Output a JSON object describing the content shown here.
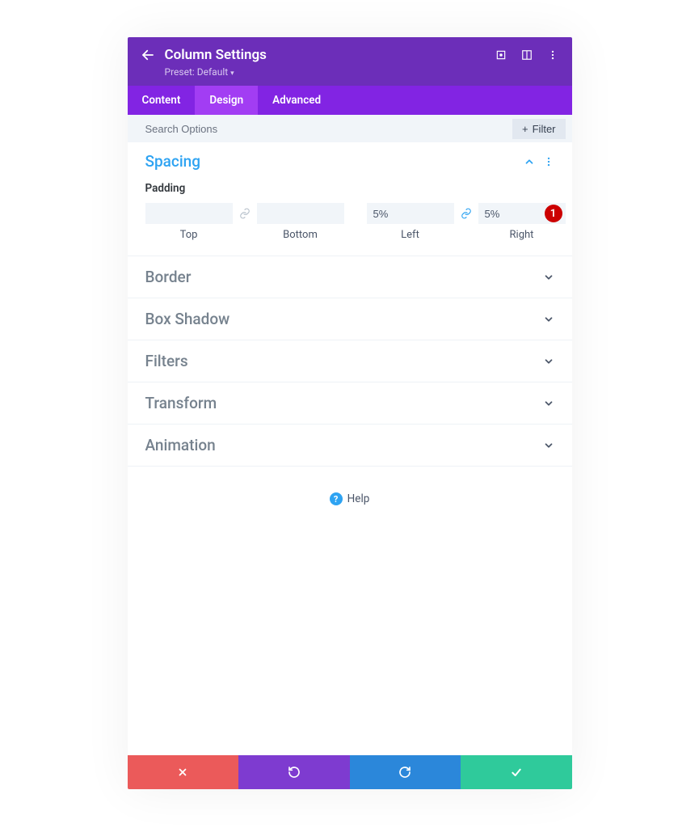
{
  "header": {
    "title": "Column Settings",
    "preset_label": "Preset:",
    "preset_value": "Default"
  },
  "tabs": [
    {
      "id": "content",
      "label": "Content",
      "active": false
    },
    {
      "id": "design",
      "label": "Design",
      "active": true
    },
    {
      "id": "advanced",
      "label": "Advanced",
      "active": false
    }
  ],
  "search": {
    "placeholder": "Search Options",
    "filter_label": "Filter"
  },
  "spacing": {
    "title": "Spacing",
    "subtitle": "Padding",
    "top": {
      "value": "",
      "label": "Top"
    },
    "bottom": {
      "value": "",
      "label": "Bottom"
    },
    "left": {
      "value": "5%",
      "label": "Left"
    },
    "right": {
      "value": "5%",
      "label": "Right"
    },
    "badge": "1"
  },
  "sections": [
    {
      "id": "border",
      "title": "Border"
    },
    {
      "id": "boxshadow",
      "title": "Box Shadow"
    },
    {
      "id": "filters",
      "title": "Filters"
    },
    {
      "id": "transform",
      "title": "Transform"
    },
    {
      "id": "animation",
      "title": "Animation"
    }
  ],
  "help_label": "Help",
  "plus_glyph": "+"
}
